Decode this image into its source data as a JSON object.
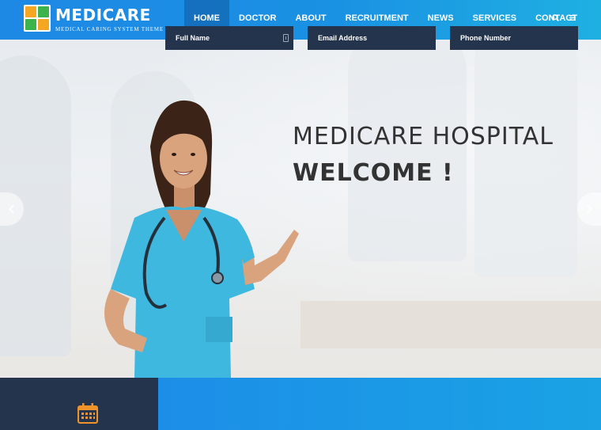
{
  "brand": {
    "name": "MEDICARE",
    "tagline": "MEDICAL CARING SYSTEM THEME",
    "logo_colors": [
      "#f5a623",
      "#3cb44b",
      "#3cb44b",
      "#f5a623"
    ]
  },
  "nav": {
    "items": [
      {
        "label": "HOME",
        "active": true
      },
      {
        "label": "DOCTOR",
        "active": false
      },
      {
        "label": "ABOUT",
        "active": false
      },
      {
        "label": "RECRUITMENT",
        "active": false
      },
      {
        "label": "NEWS",
        "active": false
      },
      {
        "label": "SERVICES",
        "active": false
      },
      {
        "label": "CONTACT",
        "active": false
      }
    ],
    "icons": [
      "search-icon",
      "menu-icon"
    ]
  },
  "hero": {
    "line1": "MEDICARE HOSPITAL",
    "line2": "WELCOME !",
    "scrub_color": "#3fb8df"
  },
  "appointment": {
    "icon": "calendar-icon",
    "icon_color": "#f0932b",
    "fields": [
      {
        "label": "Full Name",
        "has_icon": true
      },
      {
        "label": "Email Address",
        "has_icon": false
      },
      {
        "label": "Phone Number",
        "has_icon": false
      }
    ]
  },
  "colors": {
    "header_start": "#1e88e5",
    "header_end": "#1fb0e2",
    "dark_panel": "#25344d"
  }
}
